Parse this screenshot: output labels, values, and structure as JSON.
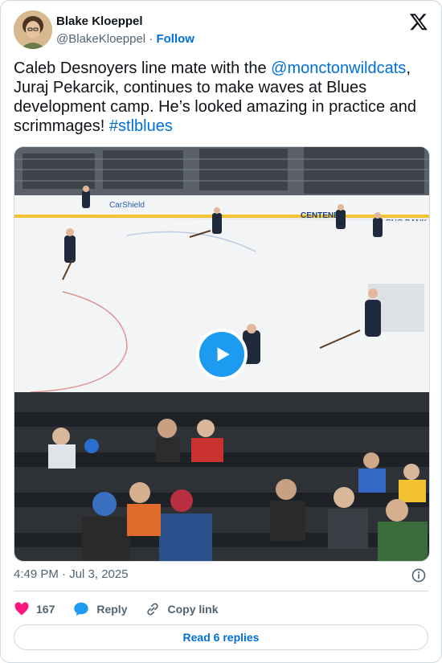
{
  "author": {
    "name": "Blake Kloeppel",
    "handle": "@BlakeKloeppel",
    "separator": " · ",
    "follow_label": "Follow"
  },
  "tweet": {
    "text_1": "Caleb Desnoyers line mate with the ",
    "mention": "@monctonwildcats",
    "text_2": ", Juraj Pekarcik, continues to make waves at Blues development camp. He’s looked amazing in practice and scrimmages! ",
    "hashtag": "#stlblues"
  },
  "media": {
    "type": "video",
    "rink_signs": [
      "CarShield",
      "CENTENE",
      "PNC BANK"
    ]
  },
  "timestamp": "4:49 PM · Jul 3, 2025",
  "actions": {
    "likes": "167",
    "reply_label": "Reply",
    "copy_label": "Copy link"
  },
  "read_replies_label": "Read 6 replies",
  "colors": {
    "link": "#006fd6",
    "play": "#1d9bf0",
    "heart": "#f91880",
    "muted": "#536471",
    "border": "#cfd9de"
  },
  "icons": [
    "x-logo-icon",
    "play-icon",
    "heart-icon",
    "reply-icon",
    "link-icon",
    "info-icon"
  ]
}
